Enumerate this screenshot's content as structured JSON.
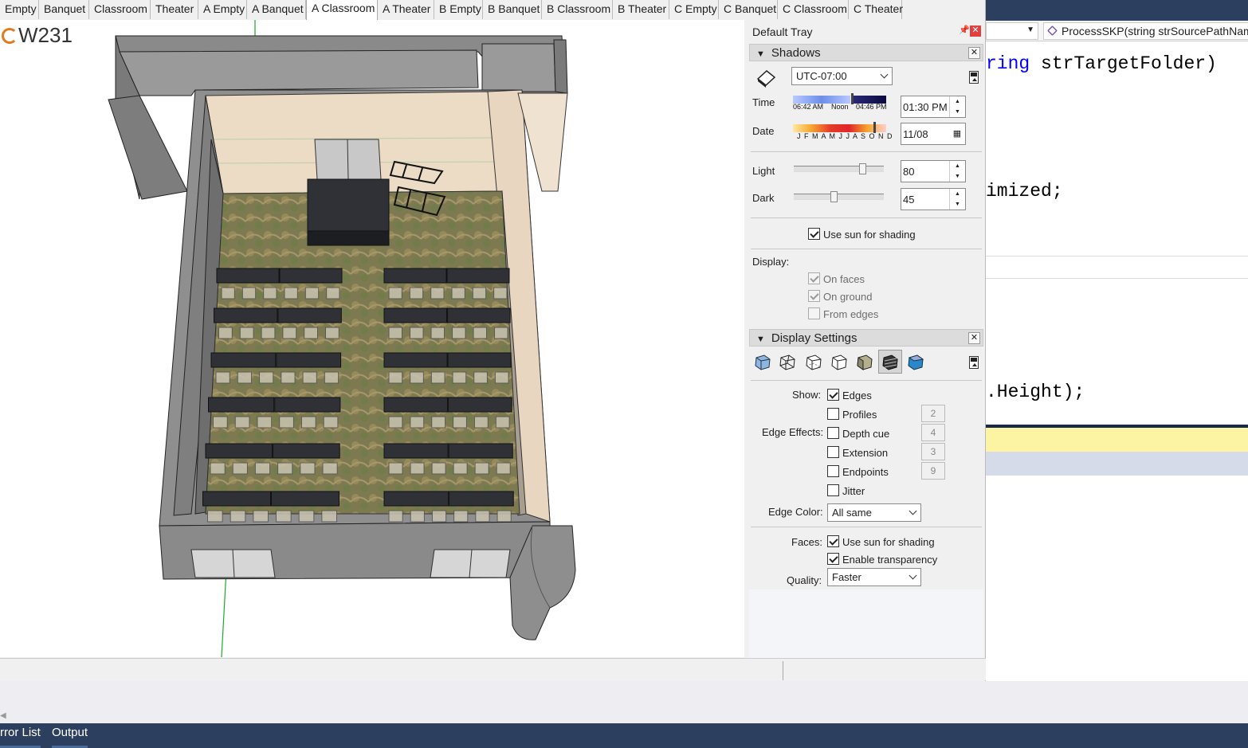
{
  "vs": {
    "nav_member": "ProcessSKP(string strSourcePathName",
    "code": [
      {
        "kw": "ring",
        "rest": " strTargetFolder)"
      },
      {
        "kw": "",
        "rest": "imized;"
      },
      {
        "kw": "",
        "rest": ".Height);"
      }
    ],
    "bottom_tabs": [
      "rror List",
      "Output"
    ]
  },
  "scene_tabs": [
    "Empty",
    "Banquet",
    "Classroom",
    "Theater",
    "A Empty",
    "A Banquet",
    "A Classroom",
    "A Theater",
    "B Empty",
    "B Banquet",
    "B Classroom",
    "B Theater",
    "C Empty",
    "C Banquet",
    "C Classroom",
    "C Theater"
  ],
  "active_scene": "A Classroom",
  "viewport": {
    "logo_text": "W231"
  },
  "tray": {
    "title": "Default Tray",
    "pin_icon": "pin-icon",
    "shadows": {
      "title": "Shadows",
      "timezone": "UTC-07:00",
      "time_label": "Time",
      "sunrise": "06:42 AM",
      "noon": "Noon",
      "sunset": "04:46 PM",
      "time_value": "01:30 PM",
      "date_label": "Date",
      "months": "J F M A M J J A S O N D",
      "date_value": "11/08",
      "light_label": "Light",
      "light_value": "80",
      "light_level": 0.8,
      "dark_label": "Dark",
      "dark_value": "45",
      "dark_level": 0.45,
      "use_sun_label": "Use sun for shading",
      "use_sun_checked": true,
      "display_label": "Display:",
      "on_faces": "On faces",
      "on_ground": "On ground",
      "from_edges": "From edges"
    },
    "display_settings": {
      "title": "Display Settings",
      "styles": [
        "xray-style-icon",
        "wireframe-style-icon",
        "hidden-line-style-icon",
        "outline-style-icon",
        "shaded-style-icon",
        "shaded-textures-style-icon",
        "monochrome-style-icon"
      ],
      "show_label": "Show:",
      "edges": "Edges",
      "edge_effects_label": "Edge Effects:",
      "profiles": "Profiles",
      "profiles_value": "2",
      "depth_cue": "Depth cue",
      "depth_cue_value": "4",
      "extension": "Extension",
      "extension_value": "3",
      "endpoints": "Endpoints",
      "endpoints_value": "9",
      "jitter": "Jitter",
      "edge_color_label": "Edge Color:",
      "edge_color_value": "All same",
      "faces_label": "Faces:",
      "faces_use_sun": "Use sun for shading",
      "enable_transparency": "Enable transparency",
      "quality_label": "Quality:",
      "quality_value": "Faster"
    }
  },
  "colors": {
    "vs_dark": "#2d3f5e",
    "keyword": "#0000ff",
    "highlight": "#fcf4a3",
    "carpet": "#7d7a52",
    "wall": "#8c8c8c",
    "desk": "#2f3136"
  }
}
